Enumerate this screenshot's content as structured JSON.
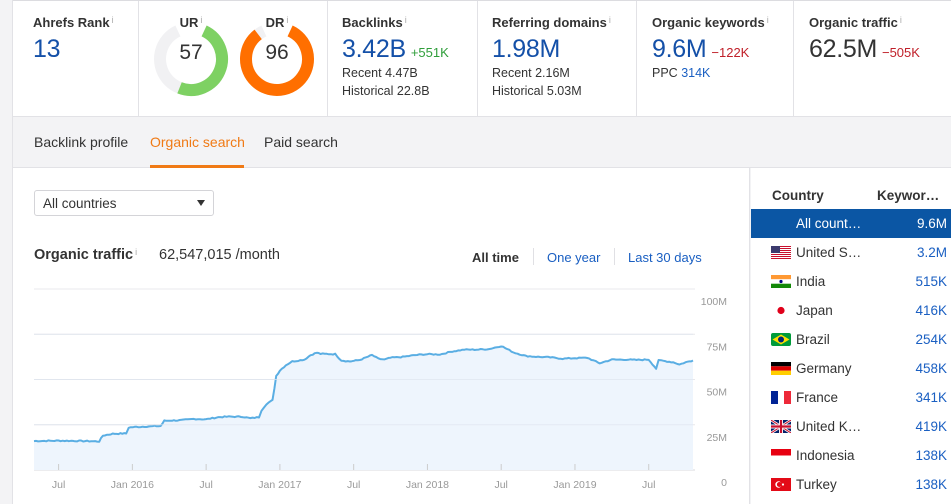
{
  "metrics": {
    "ahrefs_rank": {
      "label": "Ahrefs Rank",
      "info": "i",
      "value": "13"
    },
    "ur": {
      "label": "UR",
      "info": "i",
      "value": "57",
      "score": 57,
      "color": "#7ed163"
    },
    "dr": {
      "label": "DR",
      "info": "i",
      "value": "96",
      "score": 96,
      "color": "#ff6f00"
    },
    "backlinks": {
      "label": "Backlinks",
      "info": "i",
      "value": "3.42B",
      "delta": "+551K",
      "recent": "Recent 4.47B",
      "historical": "Historical 22.8B"
    },
    "referring_domains": {
      "label": "Referring domains",
      "info": "i",
      "value": "1.98M",
      "recent": "Recent 2.16M",
      "historical": "Historical 5.03M"
    },
    "organic_keywords": {
      "label": "Organic keywords",
      "info": "i",
      "value": "9.6M",
      "delta": "−122K",
      "ppc_label": "PPC",
      "ppc_value": "314K"
    },
    "organic_traffic": {
      "label": "Organic traffic",
      "info": "i",
      "value": "62.5M",
      "delta": "−505K"
    }
  },
  "tabs": [
    {
      "label": "Backlink profile",
      "active": false
    },
    {
      "label": "Organic search",
      "active": true
    },
    {
      "label": "Paid search",
      "active": false
    }
  ],
  "country_select": {
    "value": "All countries",
    "icon": "caret-down-icon"
  },
  "traffic_panel": {
    "title": "Organic traffic",
    "info": "i",
    "value": "62,547,015 /month",
    "ranges": [
      {
        "label": "All time",
        "active": true
      },
      {
        "label": "One year",
        "active": false
      },
      {
        "label": "Last 30 days",
        "active": false
      }
    ]
  },
  "chart_data": {
    "type": "area",
    "title": "Organic traffic",
    "xlabel": "",
    "ylabel": "",
    "ylim": [
      0,
      100000000
    ],
    "xlim": [
      "2015-05",
      "2019-10"
    ],
    "grid": true,
    "y_ticks": [
      "100M",
      "75M",
      "50M",
      "25M",
      "0"
    ],
    "y_tick_values": [
      100000000,
      75000000,
      50000000,
      25000000,
      0
    ],
    "x_ticks": [
      "Jul",
      "Jan 2016",
      "Jul",
      "Jan 2017",
      "Jul",
      "Jan 2018",
      "Jul",
      "Jan 2019",
      "Jul"
    ],
    "x_tick_months": [
      2,
      8,
      14,
      20,
      26,
      32,
      38,
      44,
      50
    ],
    "line_color": "#5aaee3",
    "fill_color": "#eef5fd",
    "series": [
      {
        "name": "Organic traffic",
        "x_months": [
          0,
          2,
          4,
          5.3,
          5.6,
          6.4,
          7.5,
          7.7,
          9.0,
          10.3,
          10.6,
          12.0,
          13.0,
          14.0,
          15.0,
          16.0,
          17.0,
          17.6,
          18.3,
          18.5,
          18.9,
          19.4,
          19.7,
          20.0,
          20.5,
          21.0,
          22.0,
          22.5,
          23.0,
          23.3,
          24.5,
          25.0,
          25.7,
          26.5,
          27.5,
          28.0,
          28.5,
          29.0,
          30.0,
          31.0,
          32.0,
          33.0,
          34.0,
          35.0,
          36.0,
          37.0,
          38.0,
          39.0,
          40.0,
          41.0,
          42.0,
          43.0,
          44.0,
          45.0,
          46.0,
          47.0,
          48.0,
          49.0,
          50.0,
          50.6,
          50.8,
          51.0,
          52.0,
          52.5,
          53.0,
          53.6
        ],
        "values_m": [
          16.0,
          16.2,
          16.0,
          15.8,
          19.0,
          20.0,
          20.2,
          23.5,
          24.0,
          24.3,
          27.2,
          27.5,
          28.2,
          28.0,
          29.2,
          29.5,
          29.4,
          28.6,
          29.2,
          33.0,
          36.5,
          38.5,
          52.0,
          55.0,
          58.0,
          60.0,
          61.0,
          63.5,
          64.8,
          64.2,
          64.0,
          60.5,
          60.0,
          60.8,
          63.5,
          61.5,
          61.0,
          62.0,
          62.5,
          63.5,
          64.0,
          63.8,
          65.5,
          66.5,
          66.5,
          66.8,
          68.5,
          65.0,
          63.0,
          62.5,
          62.2,
          61.5,
          61.8,
          62.0,
          59.0,
          61.0,
          61.0,
          60.8,
          61.0,
          56.0,
          60.5,
          60.5,
          59.5,
          58.3,
          59.5,
          60.5
        ]
      }
    ]
  },
  "country_table": {
    "headers": {
      "country": "Country",
      "keywords": "Keywor…"
    },
    "rows": [
      {
        "flag": "all",
        "name": "All count…",
        "value": "9.6M",
        "selected": true
      },
      {
        "flag": "us",
        "name": "United S…",
        "value": "3.2M",
        "selected": false
      },
      {
        "flag": "in",
        "name": "India",
        "value": "515K",
        "selected": false
      },
      {
        "flag": "jp",
        "name": "Japan",
        "value": "416K",
        "selected": false
      },
      {
        "flag": "br",
        "name": "Brazil",
        "value": "254K",
        "selected": false
      },
      {
        "flag": "de",
        "name": "Germany",
        "value": "458K",
        "selected": false
      },
      {
        "flag": "fr",
        "name": "France",
        "value": "341K",
        "selected": false
      },
      {
        "flag": "gb",
        "name": "United K…",
        "value": "419K",
        "selected": false
      },
      {
        "flag": "id",
        "name": "Indonesia",
        "value": "138K",
        "selected": false
      },
      {
        "flag": "tr",
        "name": "Turkey",
        "value": "138K",
        "selected": false
      }
    ]
  }
}
